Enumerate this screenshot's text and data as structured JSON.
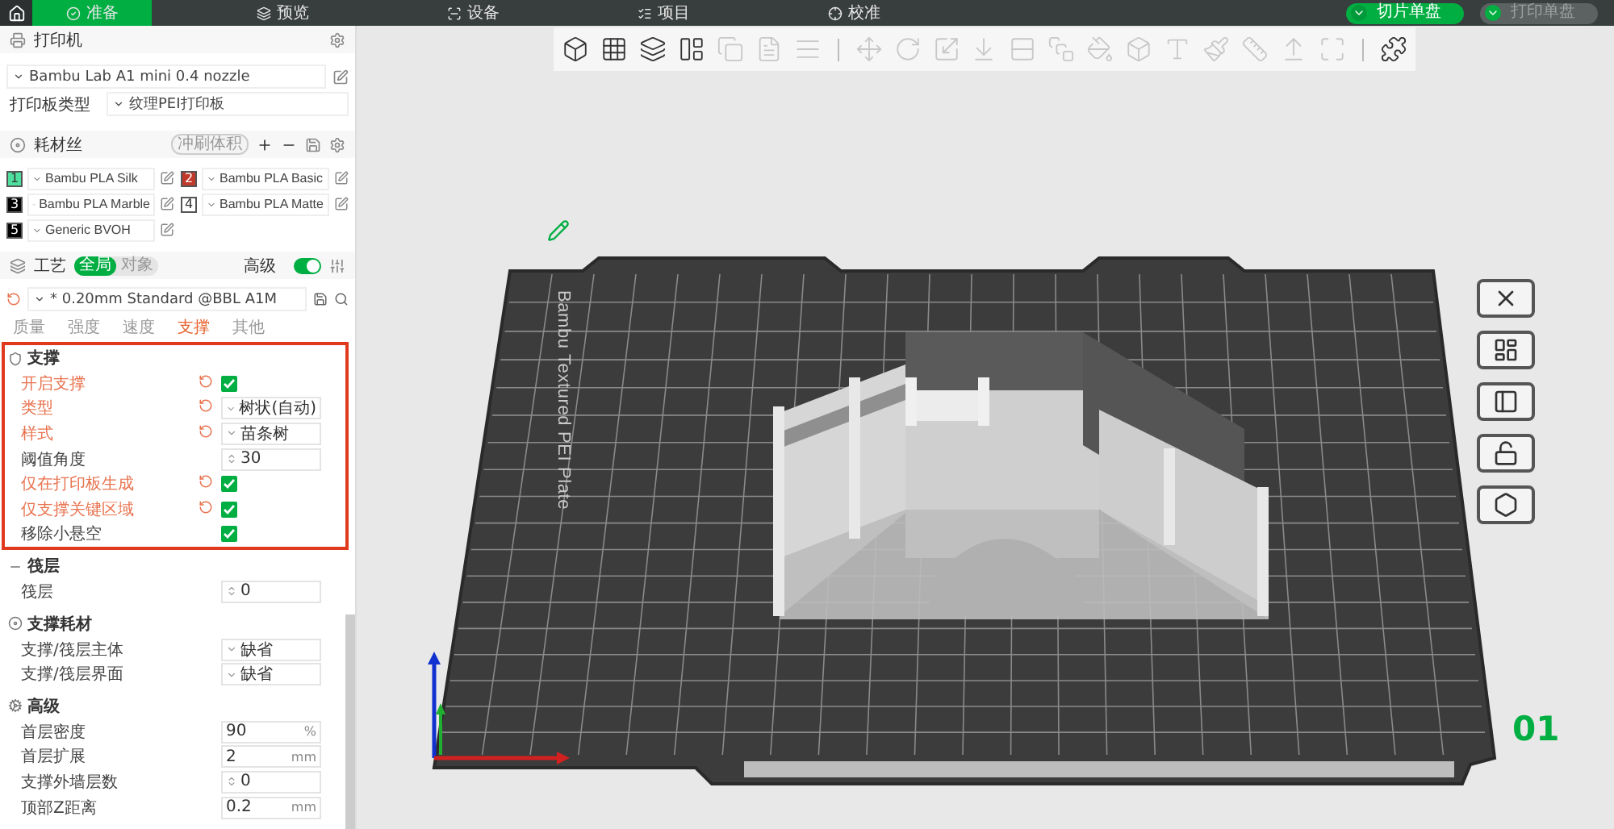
{
  "top_tabs": [
    {
      "kind": "prepare",
      "label": "准备",
      "selected": true
    },
    {
      "kind": "preview",
      "label": "预览",
      "selected": false
    },
    {
      "kind": "device",
      "label": "设备",
      "selected": false
    },
    {
      "kind": "project",
      "label": "项目",
      "selected": false
    },
    {
      "kind": "calibrate",
      "label": "校准",
      "selected": false
    }
  ],
  "actions": [
    {
      "label": "切片单盘",
      "disabled": false
    },
    {
      "label": "打印单盘",
      "disabled": true
    }
  ],
  "printer": {
    "title": "打印机",
    "preset": "Bambu Lab A1 mini 0.4 nozzle",
    "plate_type_label": "打印板类型",
    "plate_type": "纹理PEI打印板"
  },
  "filaments": {
    "title": "耗材丝",
    "badge": "冲刷体积",
    "items": [
      {
        "number": "1",
        "name": "Bambu PLA Silk",
        "color": "#4fe0a0"
      },
      {
        "number": "2",
        "name": "Bambu PLA Basic",
        "color": "#c0392b"
      },
      {
        "number": "3",
        "name": "Bambu PLA Marble",
        "color": "#000000"
      },
      {
        "number": "4",
        "name": "Bambu PLA Matte",
        "color": "#ffffff"
      },
      {
        "number": "5",
        "name": "Generic BVOH",
        "color": "#000000"
      }
    ]
  },
  "process": {
    "title": "工艺",
    "scope_tabs": [
      {
        "label": "全局",
        "selected": true
      },
      {
        "label": "对象",
        "selected": false
      }
    ],
    "advanced_label": "高级",
    "advanced_on": true,
    "preset": "* 0.20mm Standard @BBL A1M",
    "preset_modified": true,
    "tabs": [
      {
        "label": "质量",
        "selected": false
      },
      {
        "label": "强度",
        "selected": false
      },
      {
        "label": "速度",
        "selected": false
      },
      {
        "label": "支撑",
        "selected": true
      },
      {
        "label": "其他",
        "selected": false
      }
    ]
  },
  "sections": [
    {
      "kind": "support",
      "title": "支撑",
      "highlighted": true,
      "rows": [
        {
          "kind": "checkbox",
          "label": "开启支撑",
          "modified": true,
          "checked": true
        },
        {
          "kind": "select",
          "label": "类型",
          "modified": true,
          "value": "树状(自动)"
        },
        {
          "kind": "select",
          "label": "样式",
          "modified": true,
          "value": "苗条树"
        },
        {
          "kind": "spin",
          "label": "阈值角度",
          "modified": false,
          "value": "30"
        },
        {
          "kind": "checkbox",
          "label": "仅在打印板生成",
          "modified": true,
          "checked": true
        },
        {
          "kind": "checkbox",
          "label": "仅支撑关键区域",
          "modified": true,
          "checked": true
        },
        {
          "kind": "checkbox",
          "label": "移除小悬空",
          "modified": false,
          "checked": true
        }
      ]
    },
    {
      "kind": "raft",
      "title": "筏层",
      "highlighted": false,
      "rows": [
        {
          "kind": "spin",
          "label": "筏层",
          "modified": false,
          "value": "0"
        }
      ]
    },
    {
      "kind": "filament",
      "title": "支撑耗材",
      "highlighted": false,
      "rows": [
        {
          "kind": "select",
          "label": "支撑/筏层主体",
          "modified": false,
          "value": "缺省"
        },
        {
          "kind": "select",
          "label": "支撑/筏层界面",
          "modified": false,
          "value": "缺省"
        }
      ]
    },
    {
      "kind": "advanced",
      "title": "高级",
      "highlighted": false,
      "rows": [
        {
          "kind": "input",
          "label": "首层密度",
          "modified": false,
          "value": "90",
          "unit": "%"
        },
        {
          "kind": "input",
          "label": "首层扩展",
          "modified": false,
          "value": "2",
          "unit": "mm"
        },
        {
          "kind": "spin",
          "label": "支撑外墙层数",
          "modified": false,
          "value": "0"
        },
        {
          "kind": "input",
          "label": "顶部Z距离",
          "modified": false,
          "value": "0.2",
          "unit": "mm"
        }
      ]
    }
  ],
  "toolbar_groups": [
    {
      "tools": [
        {
          "kind": "add",
          "disabled": false
        },
        {
          "kind": "plate",
          "disabled": false
        },
        {
          "kind": "orient",
          "disabled": false
        },
        {
          "kind": "arrange",
          "disabled": false
        },
        {
          "kind": "copy",
          "disabled": true
        },
        {
          "kind": "paste",
          "disabled": true
        },
        {
          "kind": "layers",
          "disabled": true
        }
      ]
    },
    {
      "tools": [
        {
          "kind": "move",
          "disabled": true
        },
        {
          "kind": "rotate",
          "disabled": true
        },
        {
          "kind": "scale",
          "disabled": true
        },
        {
          "kind": "lay",
          "disabled": true
        },
        {
          "kind": "cut",
          "disabled": true
        },
        {
          "kind": "boolean",
          "disabled": true
        },
        {
          "kind": "support",
          "disabled": true
        },
        {
          "kind": "seam",
          "disabled": true
        },
        {
          "kind": "text",
          "disabled": true
        },
        {
          "kind": "paint",
          "disabled": true
        },
        {
          "kind": "measure",
          "disabled": true
        },
        {
          "kind": "assembly",
          "disabled": true
        },
        {
          "kind": "fit",
          "disabled": true
        }
      ]
    },
    {
      "tools": [
        {
          "kind": "explode",
          "disabled": false
        }
      ]
    }
  ],
  "viewport": {
    "plate_label": "Bambu Textured PEI Plate",
    "plate_number": "01",
    "plate_tools": [
      {
        "kind": "close"
      },
      {
        "kind": "auto"
      },
      {
        "kind": "layout"
      },
      {
        "kind": "unlock"
      },
      {
        "kind": "settings"
      }
    ]
  }
}
